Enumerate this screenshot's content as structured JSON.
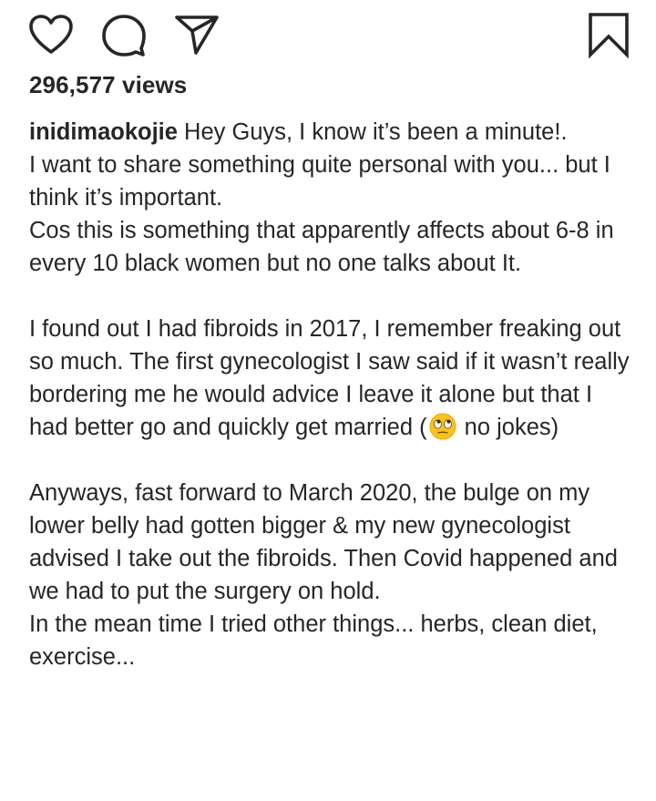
{
  "actions": {
    "like_icon": "heart-icon",
    "comment_icon": "comment-bubble-icon",
    "share_icon": "paper-plane-icon",
    "save_icon": "bookmark-icon"
  },
  "post": {
    "views": "296,577 views",
    "username": "inidimaokojie",
    "caption": {
      "p1": "Hey Guys, I know it’s been a minute!.\nI want to share something quite personal with you... but I think it’s important.\nCos this is something that apparently affects about 6-8 in every 10 black women but no one talks about It.",
      "p2_before_emoji": "I found out I had fibroids in 2017, I remember freaking out so much. The first gynecologist I saw said if it wasn’t really bordering me he would advice I leave it alone but that I had better go and quickly get married (",
      "p2_emoji": "face-with-rolling-eyes-emoji",
      "p2_after_emoji": " no jokes)",
      "p3": "Anyways, fast forward to March 2020, the bulge on my lower belly had gotten bigger & my new gynecologist advised I take out the fibroids. Then Covid happened and we had to put the surgery on hold.\nIn the mean time I tried other things... herbs, clean diet, exercise..."
    }
  },
  "colors": {
    "text": "#262626",
    "icon": "#262626",
    "background": "#ffffff",
    "emoji_face": "#fcc21b"
  }
}
